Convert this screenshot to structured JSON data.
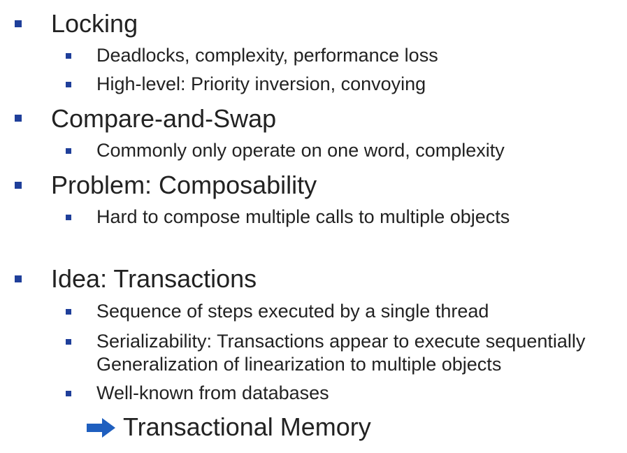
{
  "sections": [
    {
      "heading": "Locking",
      "items": [
        "Deadlocks, complexity, performance loss",
        "High-level: Priority inversion, convoying"
      ]
    },
    {
      "heading": "Compare-and-Swap",
      "items": [
        "Commonly only operate on one word, complexity"
      ]
    },
    {
      "heading": "Problem: Composability",
      "items": [
        "Hard to compose multiple calls to multiple objects"
      ]
    },
    {
      "heading": "Idea: Transactions",
      "items": [
        "Sequence of steps executed by a single thread",
        "Serializability: Transactions appear to execute sequentially",
        "Generalization of linearization to multiple objects",
        "Well-known from databases"
      ]
    }
  ],
  "conclusion": "Transactional Memory",
  "colors": {
    "bullet": "#1f3f9a",
    "arrow": "#1f5fbf",
    "text": "#222222"
  },
  "icons": {
    "bullet": "square-bullet-icon",
    "arrow": "right-arrow-icon"
  }
}
